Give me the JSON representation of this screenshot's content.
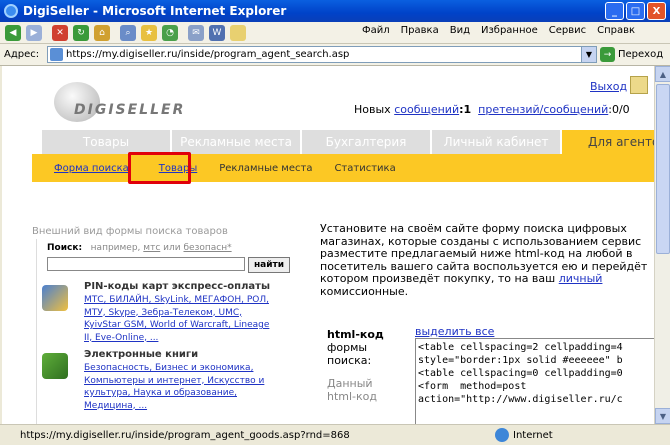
{
  "window": {
    "title": "DigiSeller - Microsoft Internet Explorer",
    "buttons": [
      "_",
      "□",
      "X"
    ]
  },
  "menu": [
    "Файл",
    "Правка",
    "Вид",
    "Избранное",
    "Сервис",
    "Справк"
  ],
  "address": {
    "label": "Адрес:",
    "url": "https://my.digiseller.ru/inside/program_agent_search.asp",
    "go": "Переход"
  },
  "header": {
    "logo": "DIGISELLER",
    "exit": "Выход",
    "news_prefix": "Новых ",
    "messages_link": "сообщений",
    "messages_count": ":1",
    "claims_link": "претензий/сообщений",
    "claims_count": ":0/0"
  },
  "tabs": [
    "Товары",
    "Рекламные места",
    "Бухгалтерия",
    "Личный кабинет",
    "Для агенто"
  ],
  "subnav": [
    "Форма поиска",
    "Товары",
    "Рекламные места",
    "Статистика"
  ],
  "preview": {
    "title": "Внешний вид формы поиска товаров",
    "search_label": "Поиск:",
    "search_hint_prefix": "например,",
    "hint_link1": "мтс",
    "hint_or": "или",
    "hint_link2": "безопасн*",
    "search_button": "найти",
    "categories": [
      {
        "title": "PIN-коды карт экспресс-оплаты",
        "links": "МТС, БИЛАЙН, SkyLink, МЕГАФОН, РОЛ, МТУ, Skype, Зебра-Телеком, UMC, KyivStar GSM, World of Warcraft, Lineage II, Eve-Online, ..."
      },
      {
        "title": "Электронные книги",
        "links": "Безопасность, Бизнес и экономика, Компьютеры и интернет, Искусство и культура, Наука и образование, Медицина, ..."
      }
    ]
  },
  "intro": {
    "text": "Установите на своём сайте форму поиска цифровых магазинах, которые созданы с использованием сервис разместите предлагаемый ниже html-код на любой в посетитель вашего сайта воспользуется ею и перейдёт котором произведёт покупку, то на ваш ",
    "link": "личный",
    "after": " комиссионные."
  },
  "code": {
    "label_bold": "html-код",
    "label": "формы поиска:",
    "preview_label": "Данный html-код",
    "select_all": "выделить все",
    "text": "<table cellspacing=2 cellpadding=4\nstyle=\"border:1px solid #eeeeee\" b\n<table cellspacing=0 cellpadding=0\n<form  method=post\naction=\"http://www.digiseller.ru/c"
  },
  "status": {
    "url": "https://my.digiseller.ru/inside/program_agent_goods.asp?rnd=868",
    "zone": "Internet"
  }
}
